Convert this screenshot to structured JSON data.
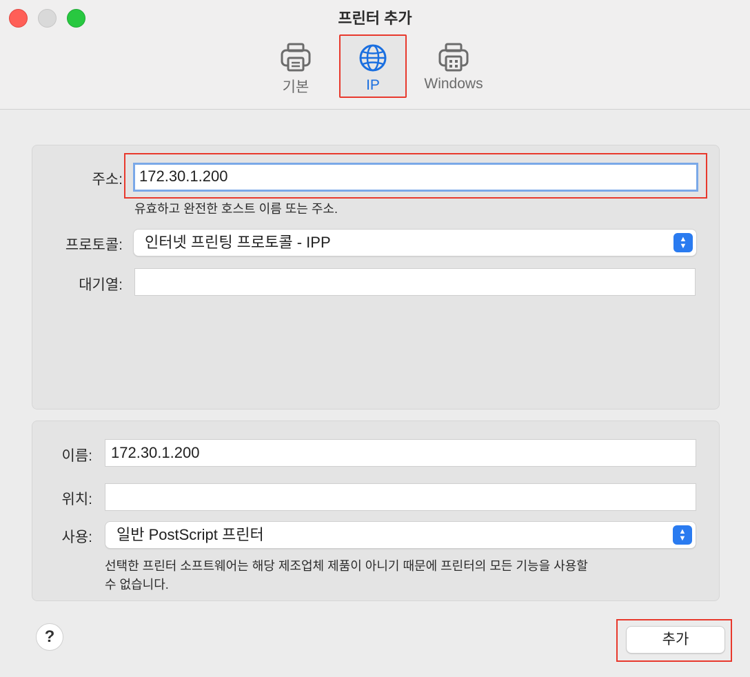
{
  "window": {
    "title": "프린터 추가"
  },
  "tabs": [
    {
      "label": "기본",
      "icon": "printer-icon"
    },
    {
      "label": "IP",
      "icon": "globe-icon"
    },
    {
      "label": "Windows",
      "icon": "windows-printer-icon"
    }
  ],
  "ip_section": {
    "address_label": "주소:",
    "address_value": "172.30.1.200",
    "address_hint": "유효하고 완전한 호스트 이름 또는 주소.",
    "protocol_label": "프로토콜:",
    "protocol_value": "인터넷 프린팅 프로토콜 - IPP",
    "queue_label": "대기열:",
    "queue_value": ""
  },
  "info_section": {
    "name_label": "이름:",
    "name_value": "172.30.1.200",
    "location_label": "위치:",
    "location_value": "",
    "use_label": "사용:",
    "use_value": "일반 PostScript 프린터",
    "warning_line1": "선택한 프린터 소프트웨어는 해당 제조업체 제품이 아니기 때문에 프린터의 모든 기능을 사용할",
    "warning_line2": "수 없습니다."
  },
  "buttons": {
    "help": "?",
    "add": "추가"
  },
  "colors": {
    "accent": "#2a7bf0",
    "highlight": "#e8382c"
  }
}
